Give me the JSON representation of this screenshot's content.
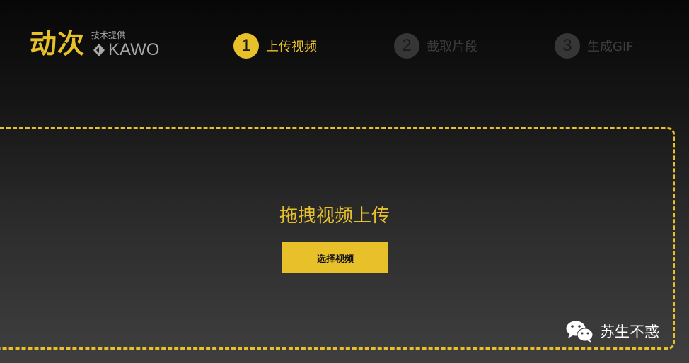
{
  "header": {
    "logo_title": "动次",
    "logo_subtitle": "技术提供",
    "logo_brand": "KAWO"
  },
  "steps": [
    {
      "number": "1",
      "label": "上传视频",
      "state": "active"
    },
    {
      "number": "2",
      "label": "截取片段",
      "state": "inactive"
    },
    {
      "number": "3",
      "label": "生成GIF",
      "state": "inactive"
    }
  ],
  "upload": {
    "drop_text": "拖拽视频上传",
    "select_button_label": "选择视频"
  },
  "watermark": {
    "text": "苏生不惑",
    "icon": "wechat-icon"
  },
  "colors": {
    "accent": "#e8c12a",
    "inactive_step": "#363636"
  }
}
